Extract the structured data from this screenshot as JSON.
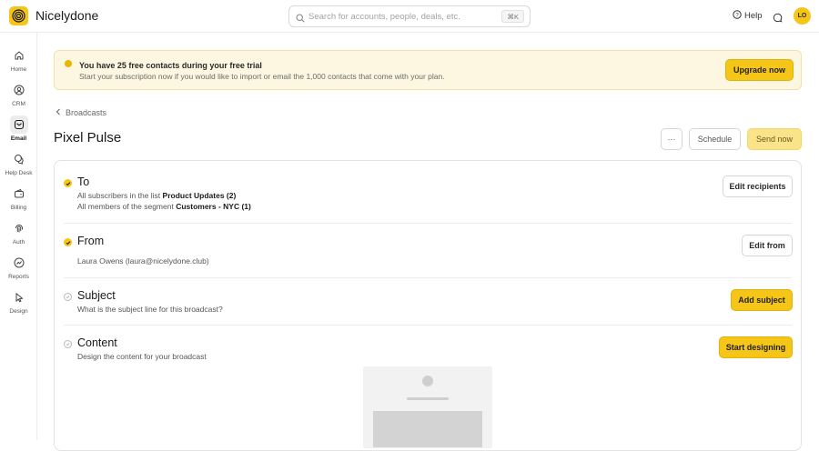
{
  "app": {
    "name": "Nicelydone"
  },
  "search": {
    "placeholder": "Search for accounts, people, deals, etc.",
    "shortcut": "⌘K"
  },
  "header": {
    "help_label": "Help",
    "avatar_initials": "LO"
  },
  "sidebar": {
    "items": [
      {
        "label": "Home",
        "icon": "home-icon"
      },
      {
        "label": "CRM",
        "icon": "person-icon"
      },
      {
        "label": "Email",
        "icon": "mail-icon",
        "active": true
      },
      {
        "label": "Help Desk",
        "icon": "chat-bubbles-icon"
      },
      {
        "label": "Billing",
        "icon": "wallet-icon"
      },
      {
        "label": "Auth",
        "icon": "fingerprint-icon"
      },
      {
        "label": "Reports",
        "icon": "chart-icon"
      },
      {
        "label": "Design",
        "icon": "pointer-icon"
      }
    ]
  },
  "banner": {
    "title": "You have 25 free contacts during your free trial",
    "text": "Start your subscription now if you would like to import or email the 1,000 contacts that come with your plan.",
    "button": "Upgrade now"
  },
  "breadcrumb": {
    "label": "Broadcasts"
  },
  "page": {
    "title": "Pixel Pulse",
    "more_label": "···",
    "schedule_label": "Schedule",
    "send_label": "Send now"
  },
  "sections": {
    "to": {
      "title": "To",
      "line1_prefix": "All subscribers in the list ",
      "line1_value": "Product Updates (2)",
      "line2_prefix": "All members of the segment ",
      "line2_value": "Customers - NYC (1)",
      "button": "Edit recipients"
    },
    "from": {
      "title": "From",
      "line": "Laura Owens (laura@nicelydone.club)",
      "button": "Edit from"
    },
    "subject": {
      "title": "Subject",
      "line": "What is the subject line for this broadcast?",
      "button": "Add subject"
    },
    "content": {
      "title": "Content",
      "line": "Design the content for your broadcast",
      "button": "Start designing"
    }
  },
  "colors": {
    "accent": "#f5c518",
    "banner_bg": "#fdf7e1"
  }
}
